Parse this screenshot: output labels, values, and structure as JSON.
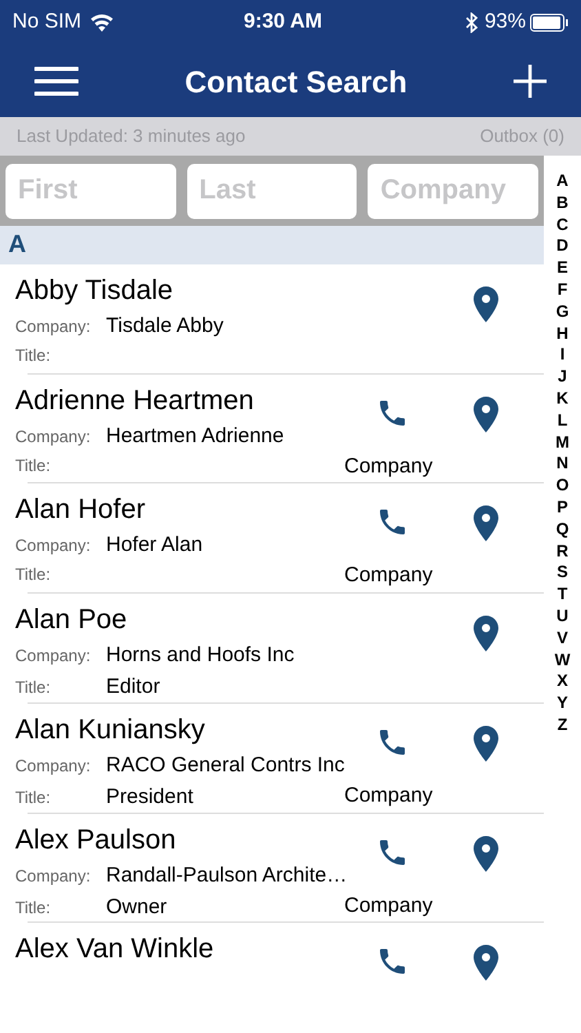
{
  "status_bar": {
    "carrier": "No SIM",
    "time": "9:30 AM",
    "battery": "93%"
  },
  "nav": {
    "title": "Contact Search"
  },
  "info_bar": {
    "last_updated": "Last Updated: 3 minutes ago",
    "outbox": "Outbox (0)"
  },
  "search": [
    {
      "placeholder": "First"
    },
    {
      "placeholder": "Last"
    },
    {
      "placeholder": "Company"
    }
  ],
  "section": "A",
  "contacts": [
    {
      "name": "Abby Tisdale",
      "company_label": "Company:",
      "company": "Tisdale Abby",
      "title_label": "Title:",
      "phone": false
    },
    {
      "name": "Adrienne Heartmen",
      "company_label": "Company:",
      "company": "Heartmen Adrienne",
      "title_label": "Title:",
      "phone": true,
      "phone_type": "Company"
    },
    {
      "name": "Alan Hofer",
      "company_label": "Company:",
      "company": "Hofer Alan",
      "title_label": "Title:",
      "phone": true,
      "phone_type": "Company"
    },
    {
      "name": "Alan Poe",
      "company_label": "Company:",
      "company": "Horns and Hoofs Inc",
      "title_label": "Title:",
      "title": "Editor",
      "phone": false
    },
    {
      "name": "Alan Kuniansky",
      "company_label": "Company:",
      "company": "RACO General Contrs Inc",
      "title_label": "Title:",
      "title": "President",
      "phone": true,
      "phone_type": "Company"
    },
    {
      "name": "Alex Paulson",
      "company_label": "Company:",
      "company": "Randall-Paulson Archite…",
      "title_label": "Title:",
      "title": "Owner",
      "phone": true,
      "phone_type": "Company"
    },
    {
      "name": "Alex Van Winkle",
      "phone": true
    }
  ],
  "index": [
    "A",
    "B",
    "C",
    "D",
    "E",
    "F",
    "G",
    "H",
    "I",
    "J",
    "K",
    "L",
    "M",
    "N",
    "O",
    "P",
    "Q",
    "R",
    "S",
    "T",
    "U",
    "V",
    "W",
    "X",
    "Y",
    "Z"
  ]
}
